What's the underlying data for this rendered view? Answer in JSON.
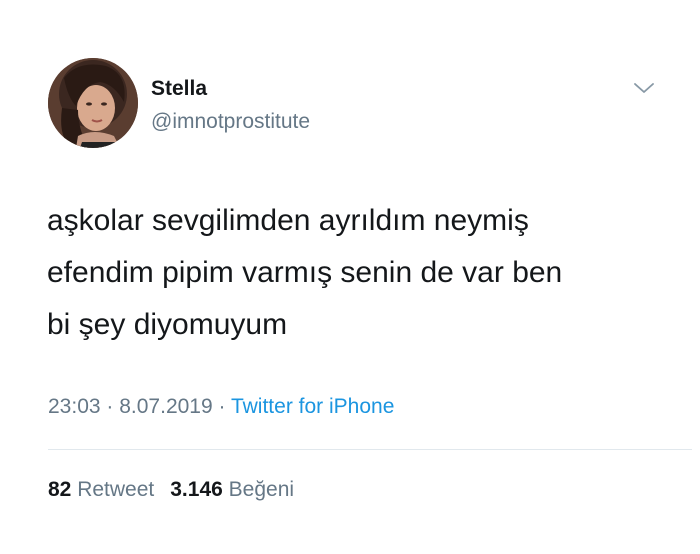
{
  "user": {
    "name": "Stella",
    "handle": "@imnotprostitute"
  },
  "tweet": {
    "text": "aşkolar sevgilimden ayrıldım neymiş\nefendim pipim varmış senin de var ben\nbi şey diyomuyum"
  },
  "meta": {
    "time": "23:03",
    "separator": " · ",
    "date": "8.07.2019",
    "source": "Twitter for iPhone"
  },
  "stats": {
    "retweet_count": "82",
    "retweet_label": "Retweet",
    "like_count": "3.146",
    "like_label": "Beğeni"
  },
  "icons": {
    "menu": "chevron-down-icon"
  },
  "colors": {
    "text": "#14171a",
    "secondary": "#657786",
    "link": "#1b95e0",
    "divider": "#e1e8ed"
  }
}
